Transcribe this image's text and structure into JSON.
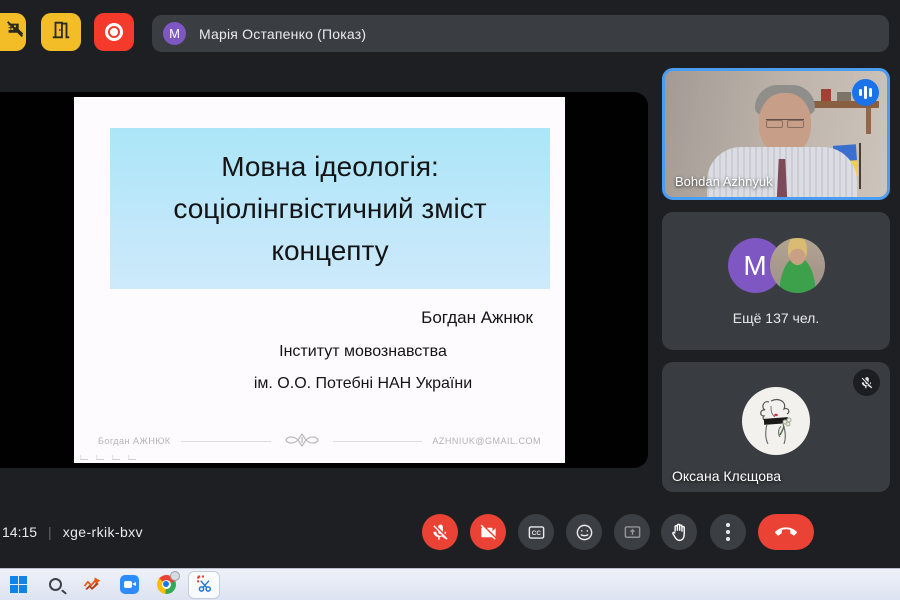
{
  "topbar": {
    "chips": [
      {
        "icon": "screen-share-warning-icon"
      },
      {
        "icon": "door-icon"
      },
      {
        "icon": "record-icon"
      }
    ],
    "presenter": {
      "avatar_letter": "М",
      "label": "Марія Остапенко (Показ)"
    }
  },
  "slide": {
    "title": "Мовна ідеологія: соціолінгвістичний зміст концепту",
    "author": "Богдан Ажнюк",
    "affiliation_line1": "Інститут мовознавства",
    "affiliation_line2": "ім. О.О. Потебні НАН України",
    "footer_left": "Богдан АЖНЮК",
    "footer_right": "AZHNIUK@GMAIL.COM"
  },
  "participants": {
    "speaker": {
      "name": "Bohdan Azhnyuk",
      "active": true,
      "indicator": "audio-level-icon"
    },
    "overflow": {
      "avatar_letter": "M",
      "label": "Ещё 137 чел."
    },
    "third": {
      "name": "Оксана Клєщова",
      "muted": true,
      "indicator": "mic-off-icon"
    }
  },
  "controls": {
    "time": "14:15",
    "separator": "|",
    "meeting_code": "xge-rkik-bxv",
    "buttons": [
      {
        "name": "microphone",
        "state": "muted"
      },
      {
        "name": "camera",
        "state": "off"
      },
      {
        "name": "captions",
        "state": "available"
      },
      {
        "name": "reactions",
        "state": "available"
      },
      {
        "name": "present",
        "state": "disabled"
      },
      {
        "name": "raise-hand",
        "state": "available"
      },
      {
        "name": "more-options",
        "state": "available"
      },
      {
        "name": "end-call",
        "state": "available"
      }
    ]
  },
  "taskbar": {
    "icons": [
      "windows-start",
      "search",
      "meta-app",
      "zoom-app",
      "chrome",
      "snipping-tool-active"
    ]
  },
  "colors": {
    "accent_blue": "#4b9df2",
    "audio_badge_blue": "#1a73e8",
    "danger_red": "#ea4335",
    "chip_yellow": "#f3bd27",
    "chip_red": "#f43a2b",
    "avatar_purple": "#7e57c2",
    "tile_gray": "#393d41",
    "slide_title_bg": "#bfe7fa"
  }
}
